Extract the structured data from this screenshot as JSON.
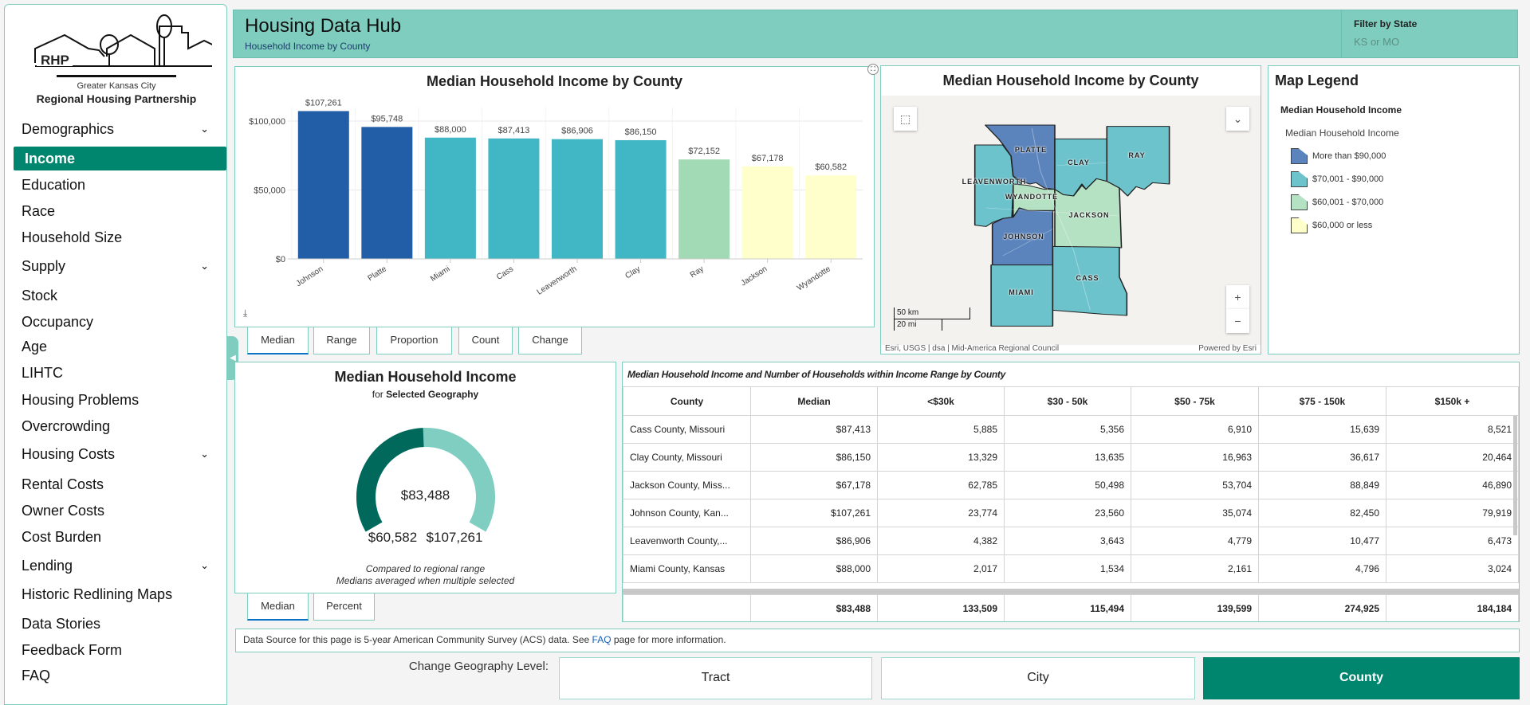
{
  "logo": {
    "mark": "RHP",
    "line1": "Greater Kansas City",
    "line2": "Regional Housing Partnership"
  },
  "sidebar": {
    "items": [
      {
        "label": "Demographics",
        "expandable": true
      },
      {
        "label": "Income",
        "active": true
      },
      {
        "label": "Education"
      },
      {
        "label": "Race"
      },
      {
        "label": "Household Size"
      },
      {
        "label": "Supply",
        "expandable": true
      },
      {
        "label": "Stock"
      },
      {
        "label": "Occupancy"
      },
      {
        "label": "Age"
      },
      {
        "label": "LIHTC"
      },
      {
        "label": "Housing Problems"
      },
      {
        "label": "Overcrowding"
      },
      {
        "label": "Housing Costs",
        "expandable": true
      },
      {
        "label": "Rental Costs"
      },
      {
        "label": "Owner Costs"
      },
      {
        "label": "Cost Burden"
      },
      {
        "label": "Lending",
        "expandable": true
      },
      {
        "label": "Historic Redlining Maps"
      },
      {
        "label": "Data Stories"
      },
      {
        "label": "Feedback Form"
      },
      {
        "label": "FAQ"
      }
    ]
  },
  "header": {
    "title": "Housing Data Hub",
    "subtitle": "Household Income by County",
    "filter_label": "Filter by State",
    "filter_value": "KS or MO"
  },
  "chart_data": {
    "type": "bar",
    "title": "Median Household Income by County",
    "categories": [
      "Johnson",
      "Platte",
      "Miami",
      "Cass",
      "Leavenworth",
      "Clay",
      "Ray",
      "Jackson",
      "Wyandotte"
    ],
    "values": [
      107261,
      95748,
      88000,
      87413,
      86906,
      86150,
      72152,
      67178,
      60582
    ],
    "value_labels": [
      "$107,261",
      "$95,748",
      "$88,000",
      "$87,413",
      "$86,906",
      "$86,150",
      "$72,152",
      "$67,178",
      "$60,582"
    ],
    "colors": [
      "#225ea8",
      "#225ea8",
      "#41b6c4",
      "#41b6c4",
      "#41b6c4",
      "#41b6c4",
      "#a1dab4",
      "#ffffcc",
      "#ffffcc"
    ],
    "yticks": [
      0,
      50000,
      100000
    ],
    "ytick_labels": [
      "$0",
      "$50,000",
      "$100,000"
    ],
    "ylim": [
      0,
      110000
    ],
    "grid": true,
    "xlabel": "",
    "ylabel": ""
  },
  "chart_tabs": [
    "Median",
    "Range",
    "Proportion",
    "Count",
    "Change"
  ],
  "map": {
    "title": "Median Household Income by County",
    "counties": [
      {
        "name": "PLATTE",
        "class": "More than $90,000"
      },
      {
        "name": "CLAY",
        "class": "$70,001 - $90,000"
      },
      {
        "name": "RAY",
        "class": "$70,001 - $90,000"
      },
      {
        "name": "LEAVENWORTH",
        "class": "$70,001 - $90,000"
      },
      {
        "name": "WYANDOTTE",
        "class": "$60,001 - $70,000"
      },
      {
        "name": "JACKSON",
        "class": "$60,001 - $70,000"
      },
      {
        "name": "JOHNSON",
        "class": "More than $90,000"
      },
      {
        "name": "CASS",
        "class": "$70,001 - $90,000"
      },
      {
        "name": "MIAMI",
        "class": "$70,001 - $90,000"
      }
    ],
    "scale_km": "50 km",
    "scale_mi": "20 mi",
    "attribution": "Esri, USGS | dsa | Mid-America Regional Council",
    "powered": "Powered by Esri",
    "zoom_in": "+",
    "zoom_out": "−"
  },
  "legend": {
    "title": "Map Legend",
    "layer": "Median Household Income",
    "field": "Median Household Income",
    "items": [
      {
        "label": "More than $90,000",
        "color": "#5b84bd"
      },
      {
        "label": "$70,001 - $90,000",
        "color": "#6cc3cc"
      },
      {
        "label": "$60,001 - $70,000",
        "color": "#b6e2c4"
      },
      {
        "label": "$60,000 or less",
        "color": "#ffffcc"
      }
    ]
  },
  "gauge": {
    "title": "Median Household Income",
    "sub_prefix": "for",
    "sub_bold": "Selected Geography",
    "value": 83488,
    "min": 60582,
    "max": 107261,
    "value_label": "$83,488",
    "min_label": "$60,582",
    "max_label": "$107,261",
    "note1": "Compared to regional range",
    "note2": "Medians averaged when multiple selected",
    "tabs": [
      "Median",
      "Percent"
    ],
    "colors": {
      "fill": "#00695c",
      "track": "#80cdc1"
    }
  },
  "table": {
    "caption": "Median Household Income and Number of Households within Income Range by County",
    "columns": [
      "County",
      "Median",
      "<$30k",
      "$30 - 50k",
      "$50 - 75k",
      "$75 - 150k",
      "$150k +"
    ],
    "rows": [
      [
        "Cass County, Missouri",
        "$87,413",
        "5,885",
        "5,356",
        "6,910",
        "15,639",
        "8,521"
      ],
      [
        "Clay County, Missouri",
        "$86,150",
        "13,329",
        "13,635",
        "16,963",
        "36,617",
        "20,464"
      ],
      [
        "Jackson County, Miss...",
        "$67,178",
        "62,785",
        "50,498",
        "53,704",
        "88,849",
        "46,890"
      ],
      [
        "Johnson County, Kan...",
        "$107,261",
        "23,774",
        "23,560",
        "35,074",
        "82,450",
        "79,919"
      ],
      [
        "Leavenworth County,...",
        "$86,906",
        "4,382",
        "3,643",
        "4,779",
        "10,477",
        "6,473"
      ],
      [
        "Miami County, Kansas",
        "$88,000",
        "2,017",
        "1,534",
        "2,161",
        "4,796",
        "3,024"
      ]
    ],
    "totals": [
      "",
      "$83,488",
      "133,509",
      "115,494",
      "139,599",
      "274,925",
      "184,184"
    ]
  },
  "footer": {
    "source_pre": "Data Source for this page is 5-year American Community Survey (ACS) data. See ",
    "faq_link": "FAQ",
    "source_post": " page for more information."
  },
  "geography": {
    "label": "Change Geography Level:",
    "options": [
      "Tract",
      "City",
      "County"
    ],
    "selected": "County"
  }
}
